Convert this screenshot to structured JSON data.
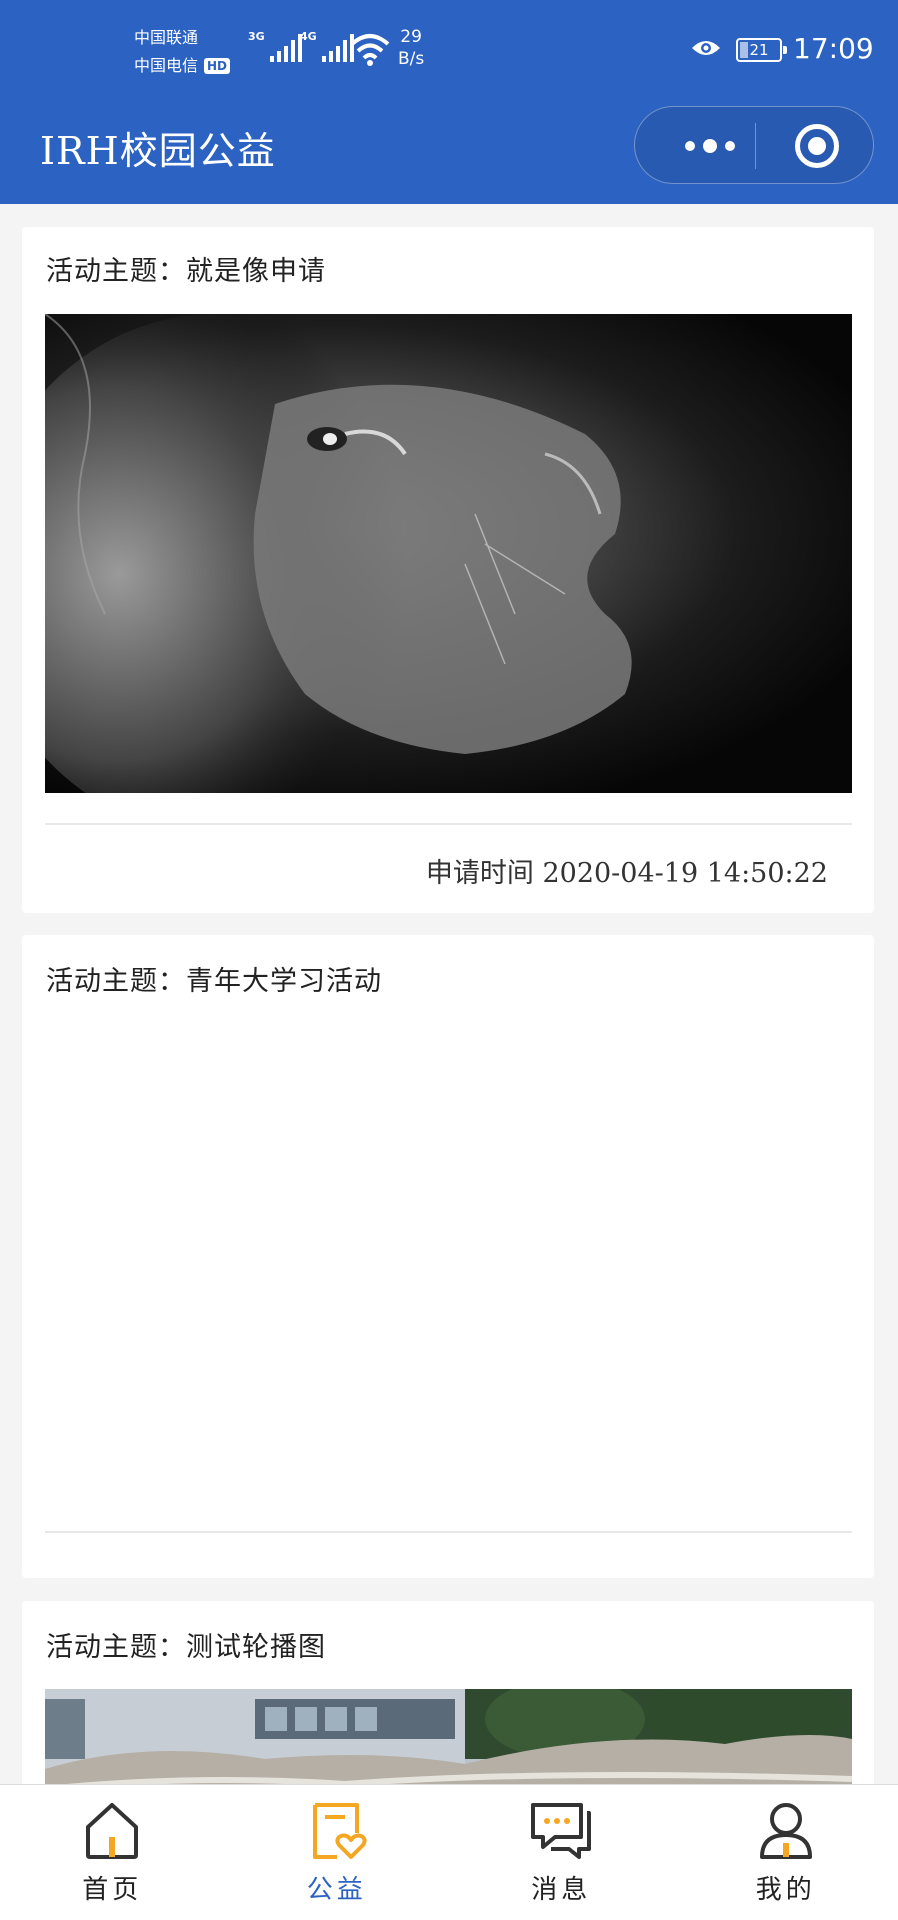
{
  "status_bar": {
    "carrier1": "中国联通",
    "carrier2": "中国电信",
    "hd": "HD",
    "net1": "3G",
    "net2": "4G",
    "speed_value": "29",
    "speed_unit": "B/s",
    "battery": "21",
    "time": "17:09"
  },
  "header": {
    "title": "IRH校园公益"
  },
  "cards": [
    {
      "title": "活动主题：就是像申请",
      "image": "lion-photo",
      "time_label": "申请时间",
      "time": "2020-04-19 14:50:22"
    },
    {
      "title": "活动主题：青年大学习活动"
    },
    {
      "title": "活动主题：测试轮播图",
      "image": "campus-photo"
    }
  ],
  "tabbar": {
    "active": "公益",
    "items": [
      {
        "label": "首页",
        "icon": "home-icon"
      },
      {
        "label": "公益",
        "icon": "charity-icon"
      },
      {
        "label": "消息",
        "icon": "message-icon"
      },
      {
        "label": "我的",
        "icon": "user-icon"
      }
    ]
  },
  "colors": {
    "primary": "#2c62c1",
    "accent": "#f5a623"
  }
}
